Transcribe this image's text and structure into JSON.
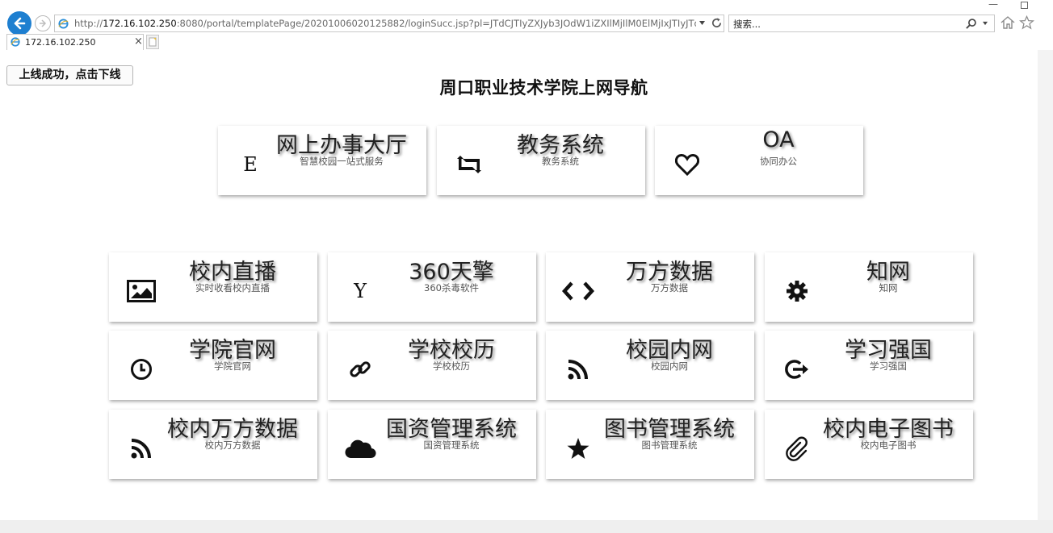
{
  "browser": {
    "url_prefix": "http://",
    "url_host": "172.16.102.250",
    "url_rest": ":8080/portal/templatePage/20201006020125882/loginSucc.jsp?pl=JTdCJTIyZXJyb3JOdW1iZXIlMjIlM0ElMjIxJTIyJTdDJTIyaGVhcnRCZ",
    "search_placeholder": "搜索...",
    "tab_title": "172.16.102.250",
    "tab_close": "×"
  },
  "page": {
    "logout_button": "上线成功，点击下线",
    "title": "周口职业技术学院上网导航"
  },
  "cards_top": [
    {
      "title": "网上办事大厅",
      "subtitle": "智慧校园一站式服务",
      "icon": "E",
      "icon_name": "letter-e-icon"
    },
    {
      "title": "教务系统",
      "subtitle": "教务系统",
      "icon": "",
      "icon_name": "retweet-icon"
    },
    {
      "title": "OA",
      "subtitle": "协同办公",
      "icon": "",
      "icon_name": "heart-icon"
    }
  ],
  "cards_grid": [
    {
      "title": "校内直播",
      "subtitle": "实时收看校内直播",
      "icon": "",
      "icon_name": "picture-icon"
    },
    {
      "title": "360天擎",
      "subtitle": "360杀毒软件",
      "icon": "Y",
      "icon_name": "letter-y-icon"
    },
    {
      "title": "万方数据",
      "subtitle": "万方数据",
      "icon": "",
      "icon_name": "code-icon"
    },
    {
      "title": "知网",
      "subtitle": "知网",
      "icon": "",
      "icon_name": "gear-icon"
    },
    {
      "title": "学院官网",
      "subtitle": "学院官网",
      "icon": "",
      "icon_name": "clock-icon"
    },
    {
      "title": "学校校历",
      "subtitle": "学校校历",
      "icon": "",
      "icon_name": "link-icon"
    },
    {
      "title": "校园内网",
      "subtitle": "校园内网",
      "icon": "",
      "icon_name": "rss-icon"
    },
    {
      "title": "学习强国",
      "subtitle": "学习强国",
      "icon": "",
      "icon_name": "sign-out-icon"
    },
    {
      "title": "校内万方数据",
      "subtitle": "校内万方数据",
      "icon": "",
      "icon_name": "rss-icon"
    },
    {
      "title": "国资管理系统",
      "subtitle": "国资管理系统",
      "icon": "",
      "icon_name": "cloud-icon"
    },
    {
      "title": "图书管理系统",
      "subtitle": "图书管理系统",
      "icon": "",
      "icon_name": "star-icon"
    },
    {
      "title": "校内电子图书",
      "subtitle": "校内电子图书",
      "icon": "",
      "icon_name": "paperclip-icon"
    }
  ]
}
